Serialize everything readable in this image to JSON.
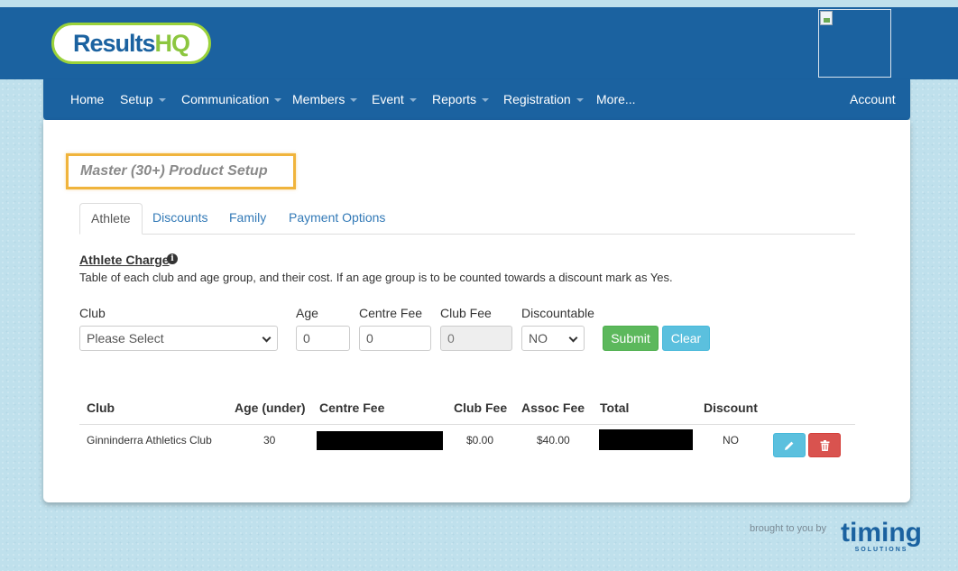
{
  "brand": {
    "logo_part1": "Results",
    "logo_part2": "HQ",
    "footer_text": "brought to you by",
    "footer_logo_word": "timing",
    "footer_logo_sub": "SOLUTIONS",
    "colors": {
      "header": "#1b62a0",
      "logo_green": "#8cc63f",
      "highlight": "#f0b43c"
    }
  },
  "nav": {
    "items": [
      {
        "label": "Home",
        "dropdown": false
      },
      {
        "label": "Setup",
        "dropdown": true
      },
      {
        "label": "Communication",
        "dropdown": true
      },
      {
        "label": "Members",
        "dropdown": true
      },
      {
        "label": "Event",
        "dropdown": true
      },
      {
        "label": "Reports",
        "dropdown": true
      },
      {
        "label": "Registration",
        "dropdown": true
      },
      {
        "label": "More...",
        "dropdown": false
      }
    ],
    "account": "Account"
  },
  "page": {
    "title": "Master (30+) Product Setup",
    "tabs": [
      "Athlete",
      "Discounts",
      "Family",
      "Payment Options"
    ],
    "active_tab": "Athlete"
  },
  "section": {
    "title": "Athlete Charge",
    "info_icon": "info-icon",
    "description": "Table of each club and age group, and their cost. If an age group is to be counted towards a discount mark as Yes."
  },
  "form": {
    "club_label": "Club",
    "club_value": "Please Select",
    "age_label": "Age",
    "age_value": "0",
    "centre_fee_label": "Centre Fee",
    "centre_fee_value": "0",
    "club_fee_label": "Club Fee",
    "club_fee_value": "0",
    "discountable_label": "Discountable",
    "discountable_value": "NO",
    "submit_label": "Submit",
    "clear_label": "Clear"
  },
  "table": {
    "headers": [
      "Club",
      "Age (under)",
      "Centre Fee",
      "Club Fee",
      "Assoc Fee",
      "Total",
      "Discount"
    ],
    "rows": [
      {
        "club": "Ginninderra Athletics Club",
        "age": "30",
        "centre_fee": "",
        "club_fee": "$0.00",
        "assoc_fee": "$40.00",
        "total": "",
        "discount": "NO",
        "actions": [
          "pencil-icon",
          "trash-icon"
        ]
      }
    ]
  }
}
